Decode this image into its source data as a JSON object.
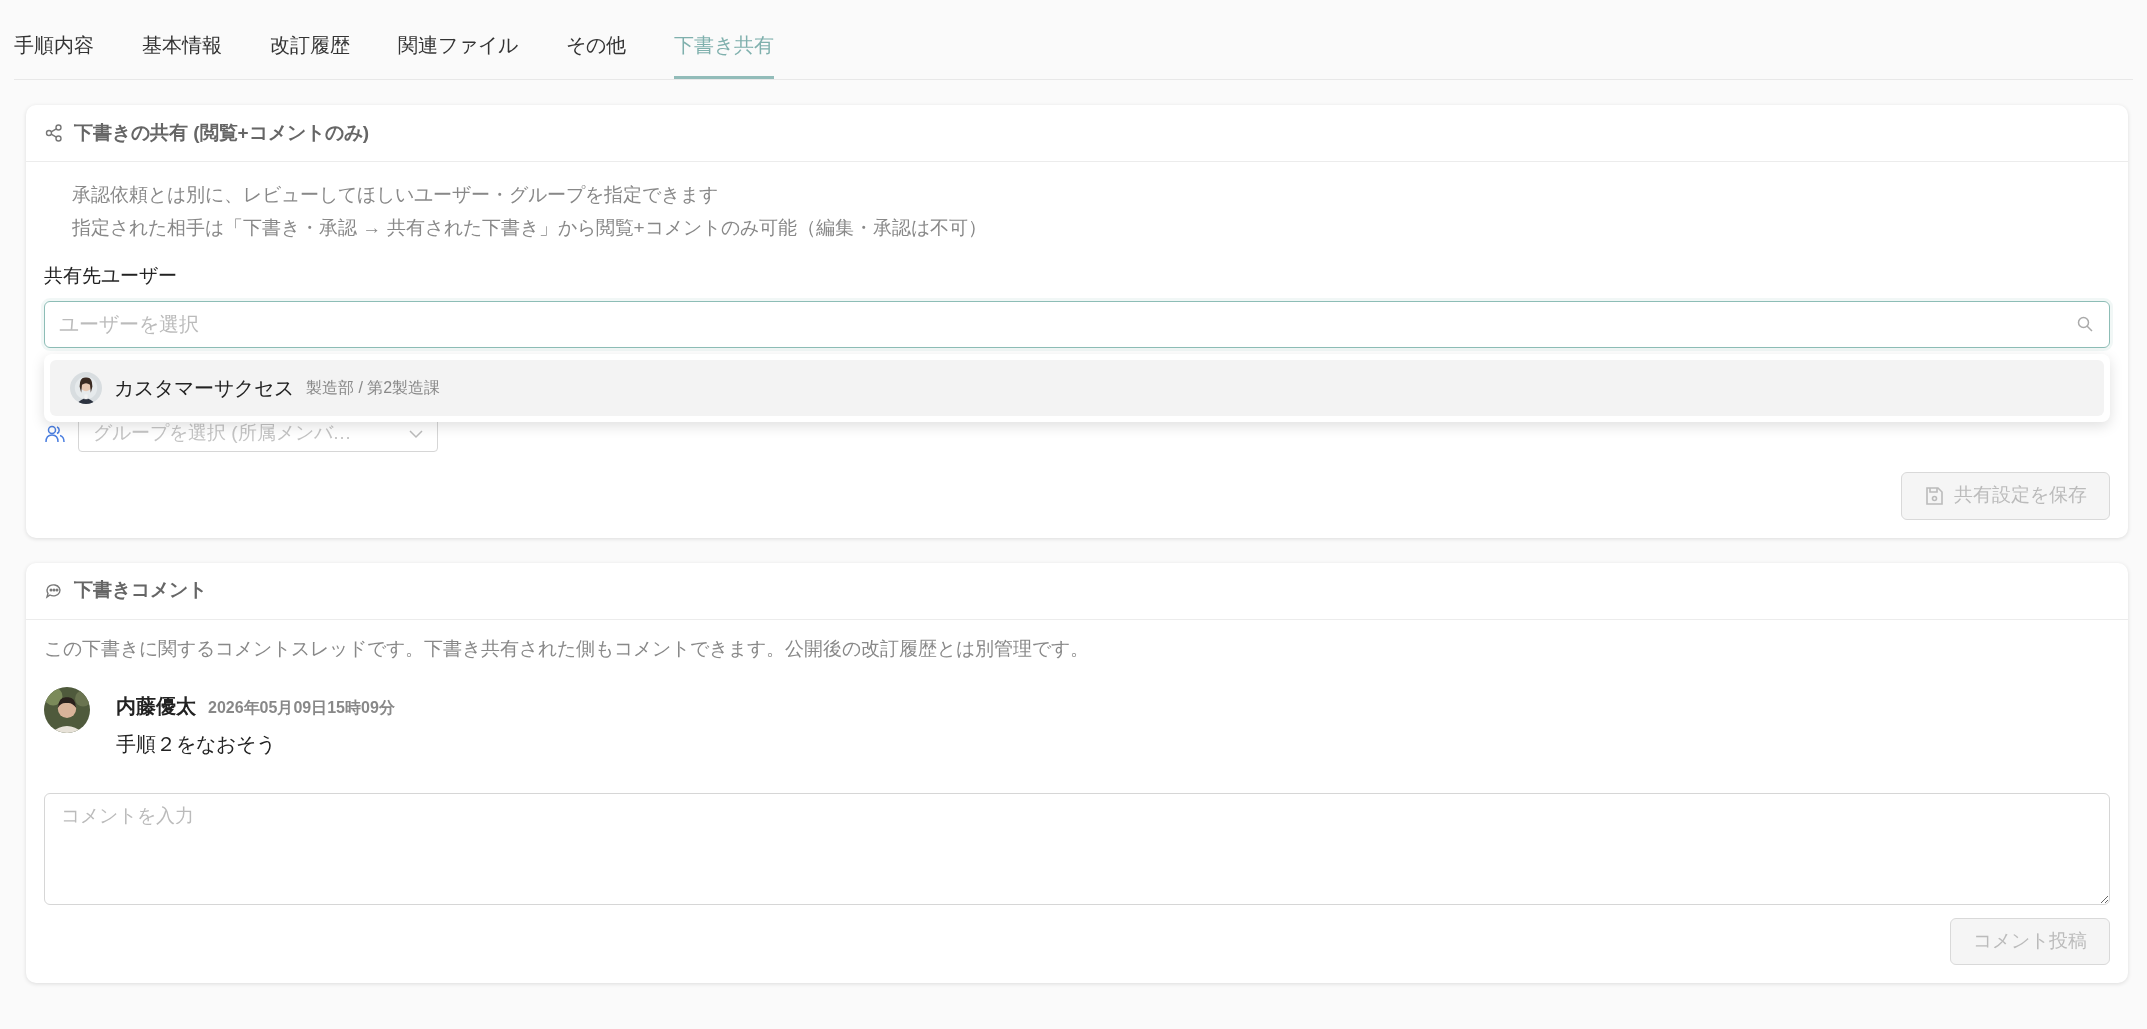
{
  "tabs": [
    {
      "label": "手順内容",
      "selected": false
    },
    {
      "label": "基本情報",
      "selected": false
    },
    {
      "label": "改訂履歴",
      "selected": false
    },
    {
      "label": "関連ファイル",
      "selected": false
    },
    {
      "label": "その他",
      "selected": false
    },
    {
      "label": "下書き共有",
      "selected": true
    }
  ],
  "share_card": {
    "title": "下書きの共有 (閲覧+コメントのみ)",
    "description": [
      "承認依頼とは別に、レビューしてほしいユーザー・グループを指定できます",
      "指定された相手は「下書き・承認 → 共有された下書き」から閲覧+コメントのみ可能（編集・承認は不可）"
    ],
    "user_field": {
      "label": "共有先ユーザー",
      "placeholder": "ユーザーを選択"
    },
    "user_options": [
      {
        "name": "カスタマーサクセス",
        "department": "製造部 / 第2製造課",
        "selected": true
      }
    ],
    "group_select": {
      "placeholder": "グループを選択 (所属メンバ…"
    },
    "save_button": {
      "label": "共有設定を保存",
      "disabled": true
    }
  },
  "comment_card": {
    "title": "下書きコメント",
    "description": "この下書きに関するコメントスレッドです。下書き共有された側もコメントできます。公開後の改訂履歴とは別管理です。",
    "comments": [
      {
        "author": "内藤優太",
        "time": "2026年05月09日15時09分",
        "text": "手順２をなおそう"
      }
    ],
    "input": {
      "placeholder": "コメントを入力"
    },
    "post_button": {
      "label": "コメント投稿",
      "disabled": true
    }
  }
}
